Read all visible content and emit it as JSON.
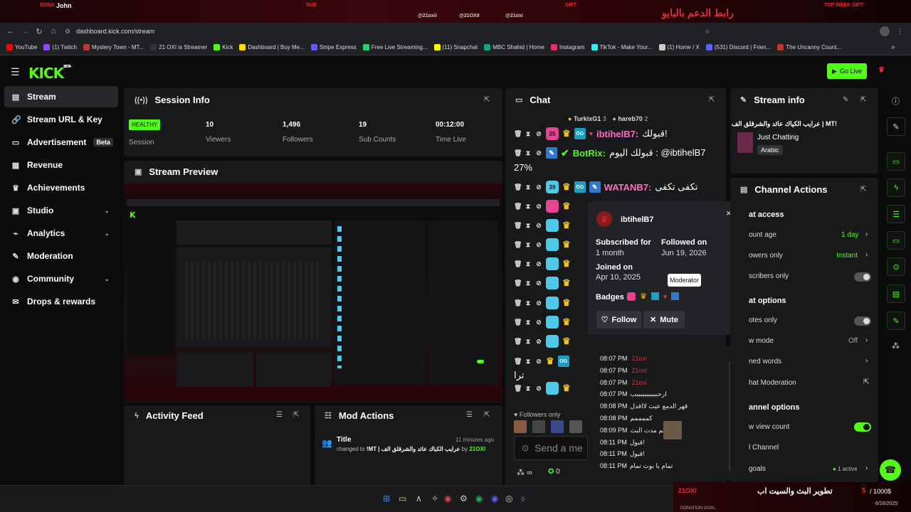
{
  "overlay": {
    "donor_label": "DONA",
    "donor_name": "John",
    "sub_label": "SUB",
    "gift_label": "GIFT",
    "top_week_label": "TOP WEEK GIFT",
    "social_1": "@21oxii",
    "social_2": "@21OXII",
    "social_3": "@21oxi",
    "arabic_banner": "رابط الدعم بالبايو"
  },
  "browser": {
    "url": "dashboard.kick.com/stream",
    "bookmarks": [
      {
        "label": "YouTube",
        "color": "#ff0000"
      },
      {
        "label": "(1) Twitch",
        "color": "#9146ff"
      },
      {
        "label": "Mystery Town - MT...",
        "color": "#c0392b"
      },
      {
        "label": "21 OXI is Streamer",
        "color": "#333333"
      },
      {
        "label": "Kick",
        "color": "#53fc18"
      },
      {
        "label": "Dashboard | Buy Me...",
        "color": "#ffdd00"
      },
      {
        "label": "Stripe Express",
        "color": "#635bff"
      },
      {
        "label": "Free Live Streaming...",
        "color": "#2ecc71"
      },
      {
        "label": "(11) Snapchat",
        "color": "#fffc00"
      },
      {
        "label": "MBC Shahid | Home",
        "color": "#16a085"
      },
      {
        "label": "Instagram",
        "color": "#e1306c"
      },
      {
        "label": "TikTok - Make Your...",
        "color": "#25f4ee"
      },
      {
        "label": "(1) Home / X",
        "color": "#cccccc"
      },
      {
        "label": "(531) Discord | Frien...",
        "color": "#5865f2"
      },
      {
        "label": "The Uncanny Count...",
        "color": "#c0392b"
      }
    ]
  },
  "header": {
    "logo": "KICK",
    "logo_sup": "BETA",
    "go_live": "Go Live"
  },
  "sidebar": {
    "items": [
      {
        "label": "Stream",
        "icon": "stream-icon",
        "glyph": "▤"
      },
      {
        "label": "Stream URL & Key",
        "icon": "link-icon",
        "glyph": "🔗"
      },
      {
        "label": "Advertisement",
        "icon": "ad-icon",
        "glyph": "▭",
        "badge": "Beta"
      },
      {
        "label": "Revenue",
        "icon": "revenue-icon",
        "glyph": "▦"
      },
      {
        "label": "Achievements",
        "icon": "trophy-icon",
        "glyph": "♛"
      },
      {
        "label": "Studio",
        "icon": "studio-icon",
        "glyph": "▣"
      },
      {
        "label": "Analytics",
        "icon": "analytics-icon",
        "glyph": "⌁"
      },
      {
        "label": "Moderation",
        "icon": "wrench-icon",
        "glyph": "✎"
      },
      {
        "label": "Community",
        "icon": "megaphone-icon",
        "glyph": "◉"
      },
      {
        "label": "Drops & rewards",
        "icon": "gift-icon",
        "glyph": "✉"
      }
    ]
  },
  "session": {
    "title": "Session Info",
    "status": "HEALTHY",
    "status_label": "Session",
    "viewers": "10",
    "viewers_label": "Viewers",
    "followers": "1,496",
    "followers_label": "Followers",
    "subs": "19",
    "subs_label": "Sub Counts",
    "time": "00:12:00",
    "time_label": "Time Live"
  },
  "preview": {
    "title": "Stream Preview"
  },
  "activity": {
    "title": "Activity Feed"
  },
  "mod_actions": {
    "title": "Mod Actions",
    "entry_title": "Title",
    "entry_time": "11 minutes ago",
    "entry_prefix": "changed to",
    "entry_value": "!MT | عرايب الكياك عائد والشرقلق الف",
    "entry_by": "by",
    "entry_user": "21OXI"
  },
  "chat": {
    "title": "Chat",
    "top_gifter_1": "TurkixG1",
    "top_gifter_1_count": "3",
    "top_gifter_2": "hareb70",
    "top_gifter_2_count": "2",
    "messages": [
      {
        "badge": "25",
        "badge_color": "#e84393",
        "user": "ibtihelB7:",
        "user_color": "#ff6ec7",
        "text": "قبولك!"
      },
      {
        "badge": "",
        "badge_color": "",
        "user": "BotRix:",
        "user_color": "#53fc18",
        "text": "قبولك اليوم : @ibtihelB7"
      },
      {
        "badge": "39",
        "badge_color": "#4ec9e8",
        "user": "WATANB7:",
        "user_color": "#ff6ec7",
        "text": "تكفى تكفى"
      }
    ],
    "continuation": "27%",
    "trailing_text": "ترا",
    "followers_only": "Followers only",
    "send_placeholder": "Send a me",
    "points": "0",
    "mode_icon": "∞"
  },
  "popup": {
    "username": "ibtihelB7",
    "subscribed_label": "Subscribed for",
    "subscribed_value": "1 month",
    "followed_label": "Followed on",
    "followed_value": "Jun 19, 2026",
    "joined_label": "Joined on",
    "joined_value": "Apr 10, 2025",
    "badges_label": "Badges",
    "tooltip": "Moderator",
    "follow": "Follow",
    "mute": "Mute"
  },
  "timestamps": [
    {
      "time": "08:07 PM",
      "text": "21oxi",
      "red": true
    },
    {
      "time": "08:07 PM",
      "text": "21oxi",
      "red": true
    },
    {
      "time": "08:07 PM",
      "text": "21oxi",
      "red": true
    },
    {
      "time": "08:07 PM",
      "text": "ارحبببببببببببب",
      "red": false
    },
    {
      "time": "08:08 PM",
      "text": "قهر الدمع عيت لااقدل",
      "red": false
    },
    {
      "time": "08:08 PM",
      "text": "كممممم",
      "red": false
    },
    {
      "time": "08:09 PM",
      "text": "كم مدت البث",
      "red": false
    },
    {
      "time": "08:11 PM",
      "text": "قبول!",
      "red": false
    },
    {
      "time": "08:11 PM",
      "text": "قبول!",
      "red": false
    },
    {
      "time": "08:11 PM",
      "text": "تمام يا بوت تمام",
      "red": false
    }
  ],
  "stream_info": {
    "title": "Stream info",
    "stream_title": "!MT | عرايب الكياك عائد والشرقلق الف",
    "category": "Just Chatting",
    "language": "Arabic"
  },
  "channel_actions": {
    "title": "Channel Actions",
    "access_head": "at access",
    "account_age": "ount age",
    "account_age_value": "1 day",
    "followers_only": "owers only",
    "followers_only_value": "Instant",
    "subscribers_only": "scribers only",
    "options_head": "at options",
    "emotes_only": "otes only",
    "slow_mode": "w mode",
    "slow_mode_value": "Off",
    "banned_words": "ned words",
    "ai_moderation": "hat Moderation",
    "channel_head": "annel options",
    "view_count": "w view count",
    "raid_channel": "l Channel",
    "goals": "goals",
    "goals_value": "1 active"
  },
  "donation": {
    "user": "21OXI",
    "text": "تطوير البث والسيت اب",
    "progress": "5",
    "target": "/ 1000$",
    "label": "DONATION GOAL",
    "date": "6/16/2025"
  }
}
